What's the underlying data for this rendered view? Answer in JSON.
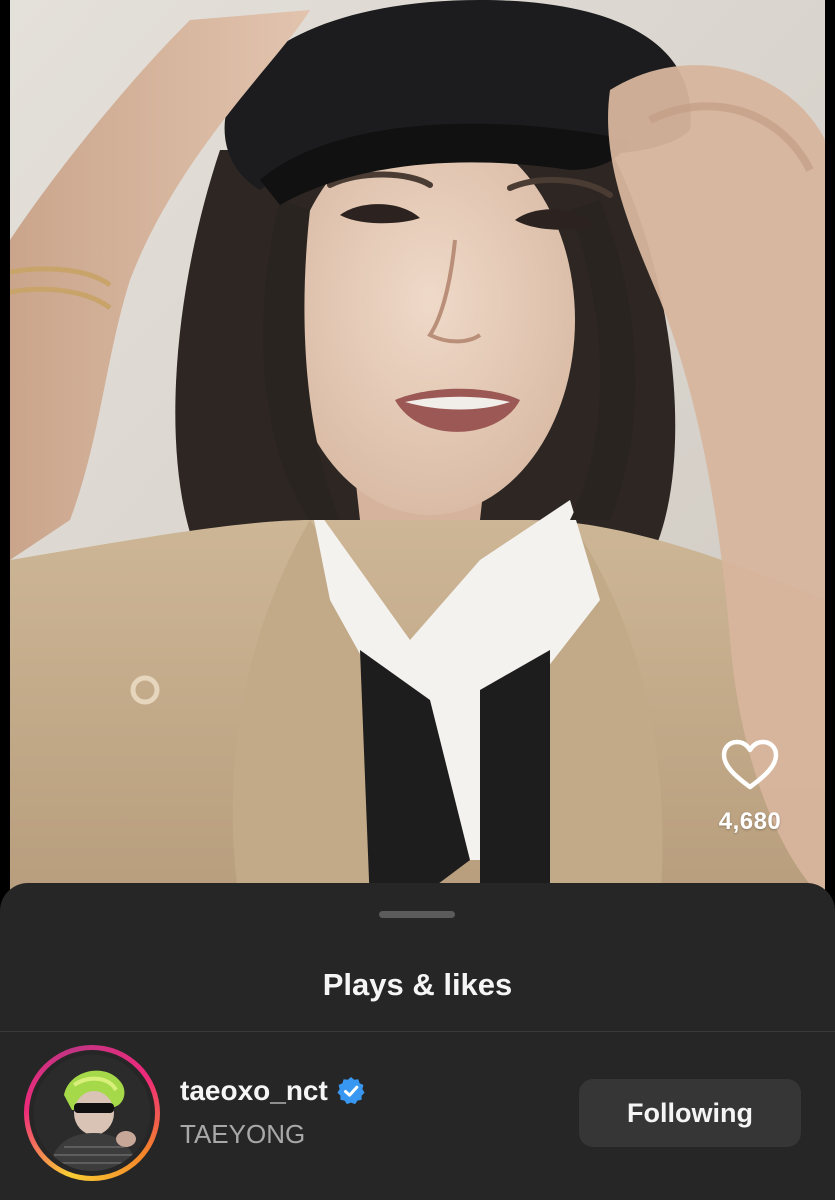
{
  "video": {
    "like_icon": "heart-outline-icon",
    "like_count": "4,680"
  },
  "sheet": {
    "title": "Plays & likes"
  },
  "user": {
    "username": "taeoxo_nct",
    "verified_icon": "verified-badge-icon",
    "display_name": "TAEYONG",
    "follow_label": "Following",
    "story_ring_colors": [
      "#f9ce34",
      "#ee2a7b",
      "#c13584",
      "#f58529"
    ],
    "verified_color": "#3897f0"
  }
}
